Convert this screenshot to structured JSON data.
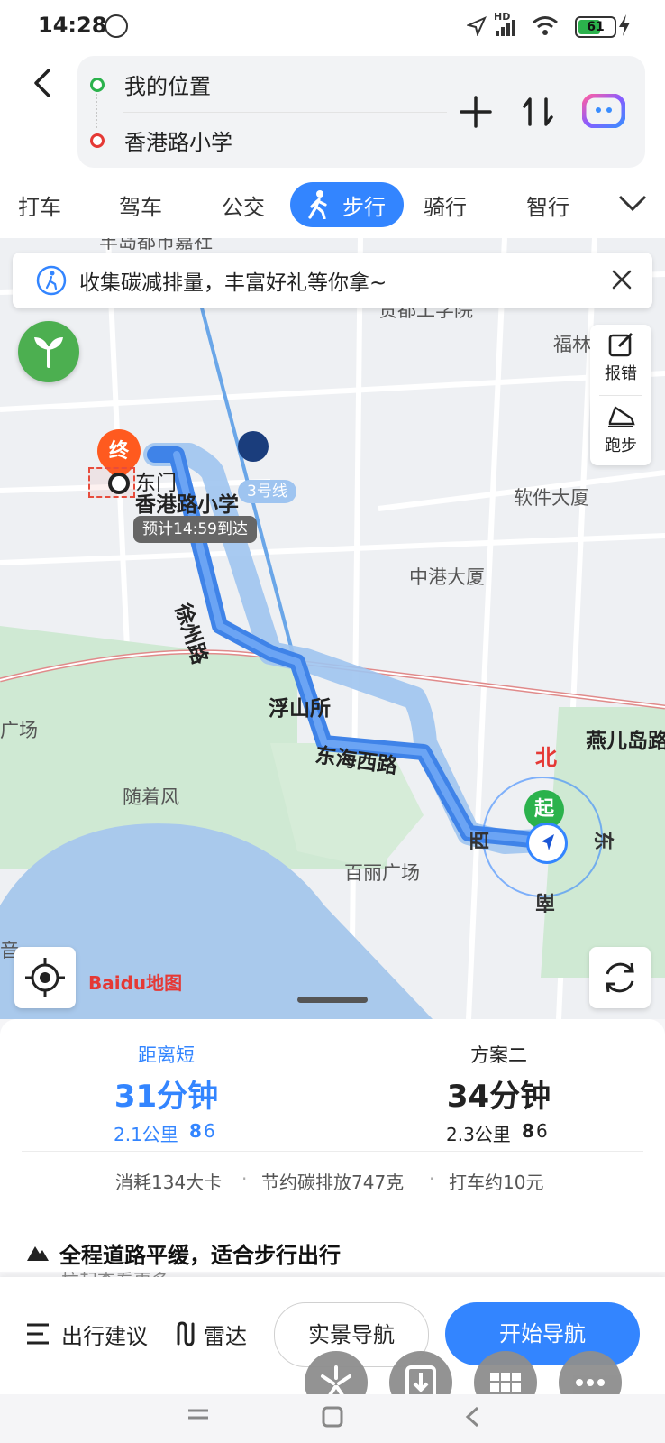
{
  "status_bar": {
    "time": "14:28",
    "network": "HD",
    "battery": "61"
  },
  "route": {
    "from": "我的位置",
    "to": "香港路小学"
  },
  "modes": {
    "taxi": "打车",
    "drive": "驾车",
    "bus": "公交",
    "walk": "步行",
    "ride": "骑行",
    "smart": "智行"
  },
  "banner": {
    "text": "收集碳减排量，丰富好礼等你拿~"
  },
  "side_panel": {
    "report": "报错",
    "run": "跑步"
  },
  "map": {
    "end_badge": "终",
    "start_badge": "起",
    "dest_gate": "东门",
    "dest_name": "香港路小学",
    "eta": "预计14:59到达",
    "metro_line": "3号线",
    "labels": {
      "top_cut": "丰岛都市嘉社",
      "school": "贵都工学院",
      "fuqi": "福林",
      "software": "软件大厦",
      "zhonggang": "中港大厦",
      "xuzhou": "徐州路",
      "fushansuo": "浮山所",
      "donghai": "东海西路",
      "yaner": "燕儿岛路",
      "guangchang": "广场",
      "suizhefeng": "随着风",
      "baili": "百丽广场",
      "yin": "音"
    },
    "compass": {
      "north": "北",
      "east": "东",
      "south": "南",
      "west": "西"
    },
    "logo": "Baidu地图"
  },
  "plans": [
    {
      "label": "距离短",
      "time": "31分钟",
      "dist": "2.1公里",
      "lights": "6",
      "color": "#3385ff"
    },
    {
      "label": "方案二",
      "time": "34分钟",
      "dist": "2.3公里",
      "lights": "6",
      "color": "#222222"
    }
  ],
  "stats": {
    "calories": "消耗134大卡",
    "carbon": "节约碳排放747克",
    "taxi": "打车约10元"
  },
  "notice": {
    "title": "全程道路平缓，适合步行出行",
    "sub": "拉起查看更多"
  },
  "actions": {
    "advice": "出行建议",
    "radar": "雷达",
    "live_nav": "实景导航",
    "start_nav": "开始导航"
  }
}
